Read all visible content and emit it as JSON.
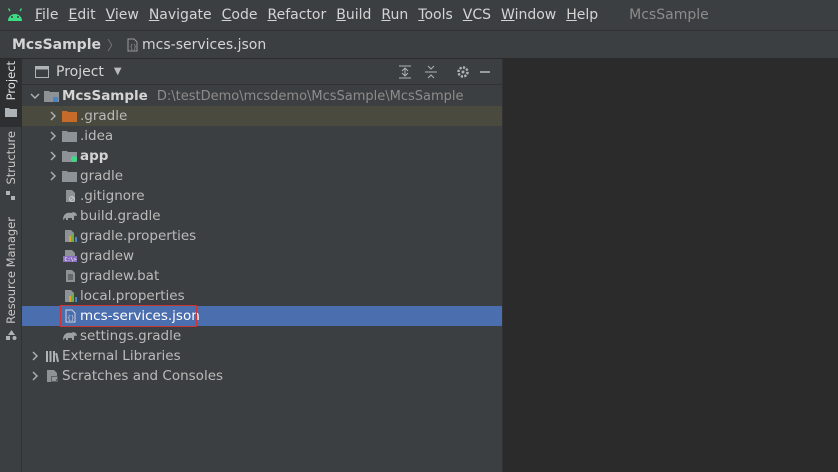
{
  "menubar": {
    "items": [
      {
        "u": "F",
        "rest": "ile"
      },
      {
        "u": "E",
        "rest": "dit"
      },
      {
        "u": "V",
        "rest": "iew"
      },
      {
        "u": "N",
        "rest": "avigate"
      },
      {
        "u": "C",
        "rest": "ode"
      },
      {
        "u": "R",
        "rest": "efactor"
      },
      {
        "u": "B",
        "rest": "uild"
      },
      {
        "u": "R",
        "rest": "un"
      },
      {
        "u": "T",
        "rest": "ools"
      },
      {
        "u": "V",
        "rest": "CS"
      },
      {
        "u": "W",
        "rest": "indow"
      },
      {
        "u": "H",
        "rest": "elp"
      }
    ],
    "project_title": "McsSample"
  },
  "breadcrumb": {
    "root": "McsSample",
    "file": "mcs-services.json"
  },
  "stripe": {
    "project": "Project",
    "structure": "Structure",
    "resource_manager": "Resource Manager"
  },
  "panel": {
    "title": "Project"
  },
  "tree": {
    "root_name": "McsSample",
    "root_path": "D:\\testDemo\\mcsdemo\\McsSample\\McsSample",
    "items": [
      {
        "label": "McsSample",
        "icon": "module-folder-icon"
      },
      {
        "label": ".gradle",
        "icon": "orange-folder-icon"
      },
      {
        "label": ".idea",
        "icon": "folder-icon"
      },
      {
        "label": "app",
        "icon": "android-module-icon"
      },
      {
        "label": "gradle",
        "icon": "folder-icon"
      },
      {
        "label": ".gitignore",
        "icon": "gitignore-file-icon"
      },
      {
        "label": "build.gradle",
        "icon": "gradle-elephant-icon"
      },
      {
        "label": "gradle.properties",
        "icon": "properties-file-icon"
      },
      {
        "label": "gradlew",
        "icon": "shell-file-icon"
      },
      {
        "label": "gradlew.bat",
        "icon": "text-file-icon"
      },
      {
        "label": "local.properties",
        "icon": "properties-file-icon"
      },
      {
        "label": "mcs-services.json",
        "icon": "json-file-icon"
      },
      {
        "label": "settings.gradle",
        "icon": "gradle-elephant-icon"
      },
      {
        "label": "External Libraries",
        "icon": "libraries-icon"
      },
      {
        "label": "Scratches and Consoles",
        "icon": "scratches-icon"
      }
    ]
  },
  "colors": {
    "selection": "#4b6eaf",
    "highlight_row": "#4b4a3f",
    "red_outline": "#c93535",
    "android_green": "#3ddc84"
  }
}
